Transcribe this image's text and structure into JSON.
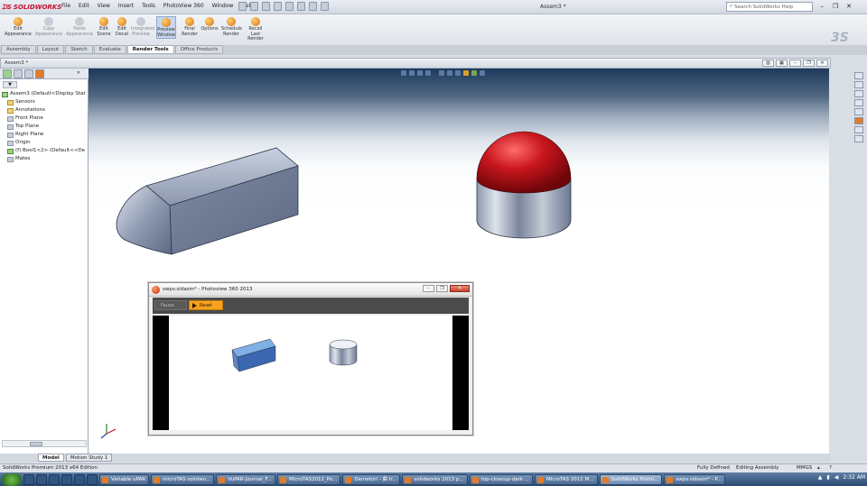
{
  "app": {
    "logo_text": "SOLIDWORKS",
    "window_title": "Assem3 *"
  },
  "menu": [
    "File",
    "Edit",
    "View",
    "Insert",
    "Tools",
    "PhotoView 360",
    "Window",
    "Help"
  ],
  "search": {
    "placeholder": "Search SolidWorks Help"
  },
  "ribbon": [
    {
      "label": "Edit Appearance",
      "state": "normal"
    },
    {
      "label": "Copy Appearance",
      "state": "dim"
    },
    {
      "label": "Paste Appearance",
      "state": "dim"
    },
    {
      "label": "Edit Scene",
      "state": "normal"
    },
    {
      "label": "Edit Decal",
      "state": "normal"
    },
    {
      "label": "Integrated Preview",
      "state": "dim"
    },
    {
      "label": "Preview Window",
      "state": "active"
    },
    {
      "label": "Final Render",
      "state": "normal"
    },
    {
      "label": "Options",
      "state": "normal"
    },
    {
      "label": "Schedule Render",
      "state": "normal"
    },
    {
      "label": "Recall Last Render",
      "state": "normal"
    }
  ],
  "tabs": [
    "Assembly",
    "Layout",
    "Sketch",
    "Evaluate",
    "Render Tools",
    "Office Products"
  ],
  "active_tab": "Render Tools",
  "document": {
    "title": "Assem3 *"
  },
  "feature_tree": [
    {
      "label": "Assem3  (Default<Display Stat",
      "icon": "assembly-icon"
    },
    {
      "label": "Sensors",
      "icon": "sensors-icon"
    },
    {
      "label": "Annotations",
      "icon": "annotations-icon"
    },
    {
      "label": "Front Plane",
      "icon": "plane-icon"
    },
    {
      "label": "Top Plane",
      "icon": "plane-icon"
    },
    {
      "label": "Right Plane",
      "icon": "plane-icon"
    },
    {
      "label": "Origin",
      "icon": "origin-icon"
    },
    {
      "label": "(f) Bool1<2> (Default<<De",
      "icon": "part-icon"
    },
    {
      "label": "Mates",
      "icon": "mates-icon"
    }
  ],
  "bottom_tabs": [
    "Model",
    "Motion Study 1"
  ],
  "active_bottom_tab": "Model",
  "preview_window": {
    "title": "swpv.sldasm* - Photoview 360 2013",
    "pause_label": "Pause",
    "reset_label": "Reset"
  },
  "status": {
    "left": "SolidWorks Premium 2013 x64 Edition",
    "fully_defined": "Fully Defined",
    "editing": "Editing Assembly",
    "units": "MMGS"
  },
  "taskbar": {
    "apps": [
      {
        "label": "Variable uPAR",
        "active": false
      },
      {
        "label": "microTAS solidwo...",
        "active": false
      },
      {
        "label": "VuPAR-Journal_F...",
        "active": false
      },
      {
        "label": "MicroTAS2012_Po...",
        "active": false
      },
      {
        "label": "Demetori - 曲 Ir...",
        "active": false
      },
      {
        "label": "solidworks 2013 p...",
        "active": false
      },
      {
        "label": "top-closeup-dark ...",
        "active": false
      },
      {
        "label": "MicroTAS 2012 M...",
        "active": false
      },
      {
        "label": "SolidWorks Premi...",
        "active": true
      },
      {
        "label": "swpv.sldasm* - P...",
        "active": false
      }
    ],
    "clock": "2:32 AM"
  },
  "colors": {
    "hemisphere": "#c8161d",
    "solid": "#aab4c8",
    "accent": "#f6a21e"
  }
}
